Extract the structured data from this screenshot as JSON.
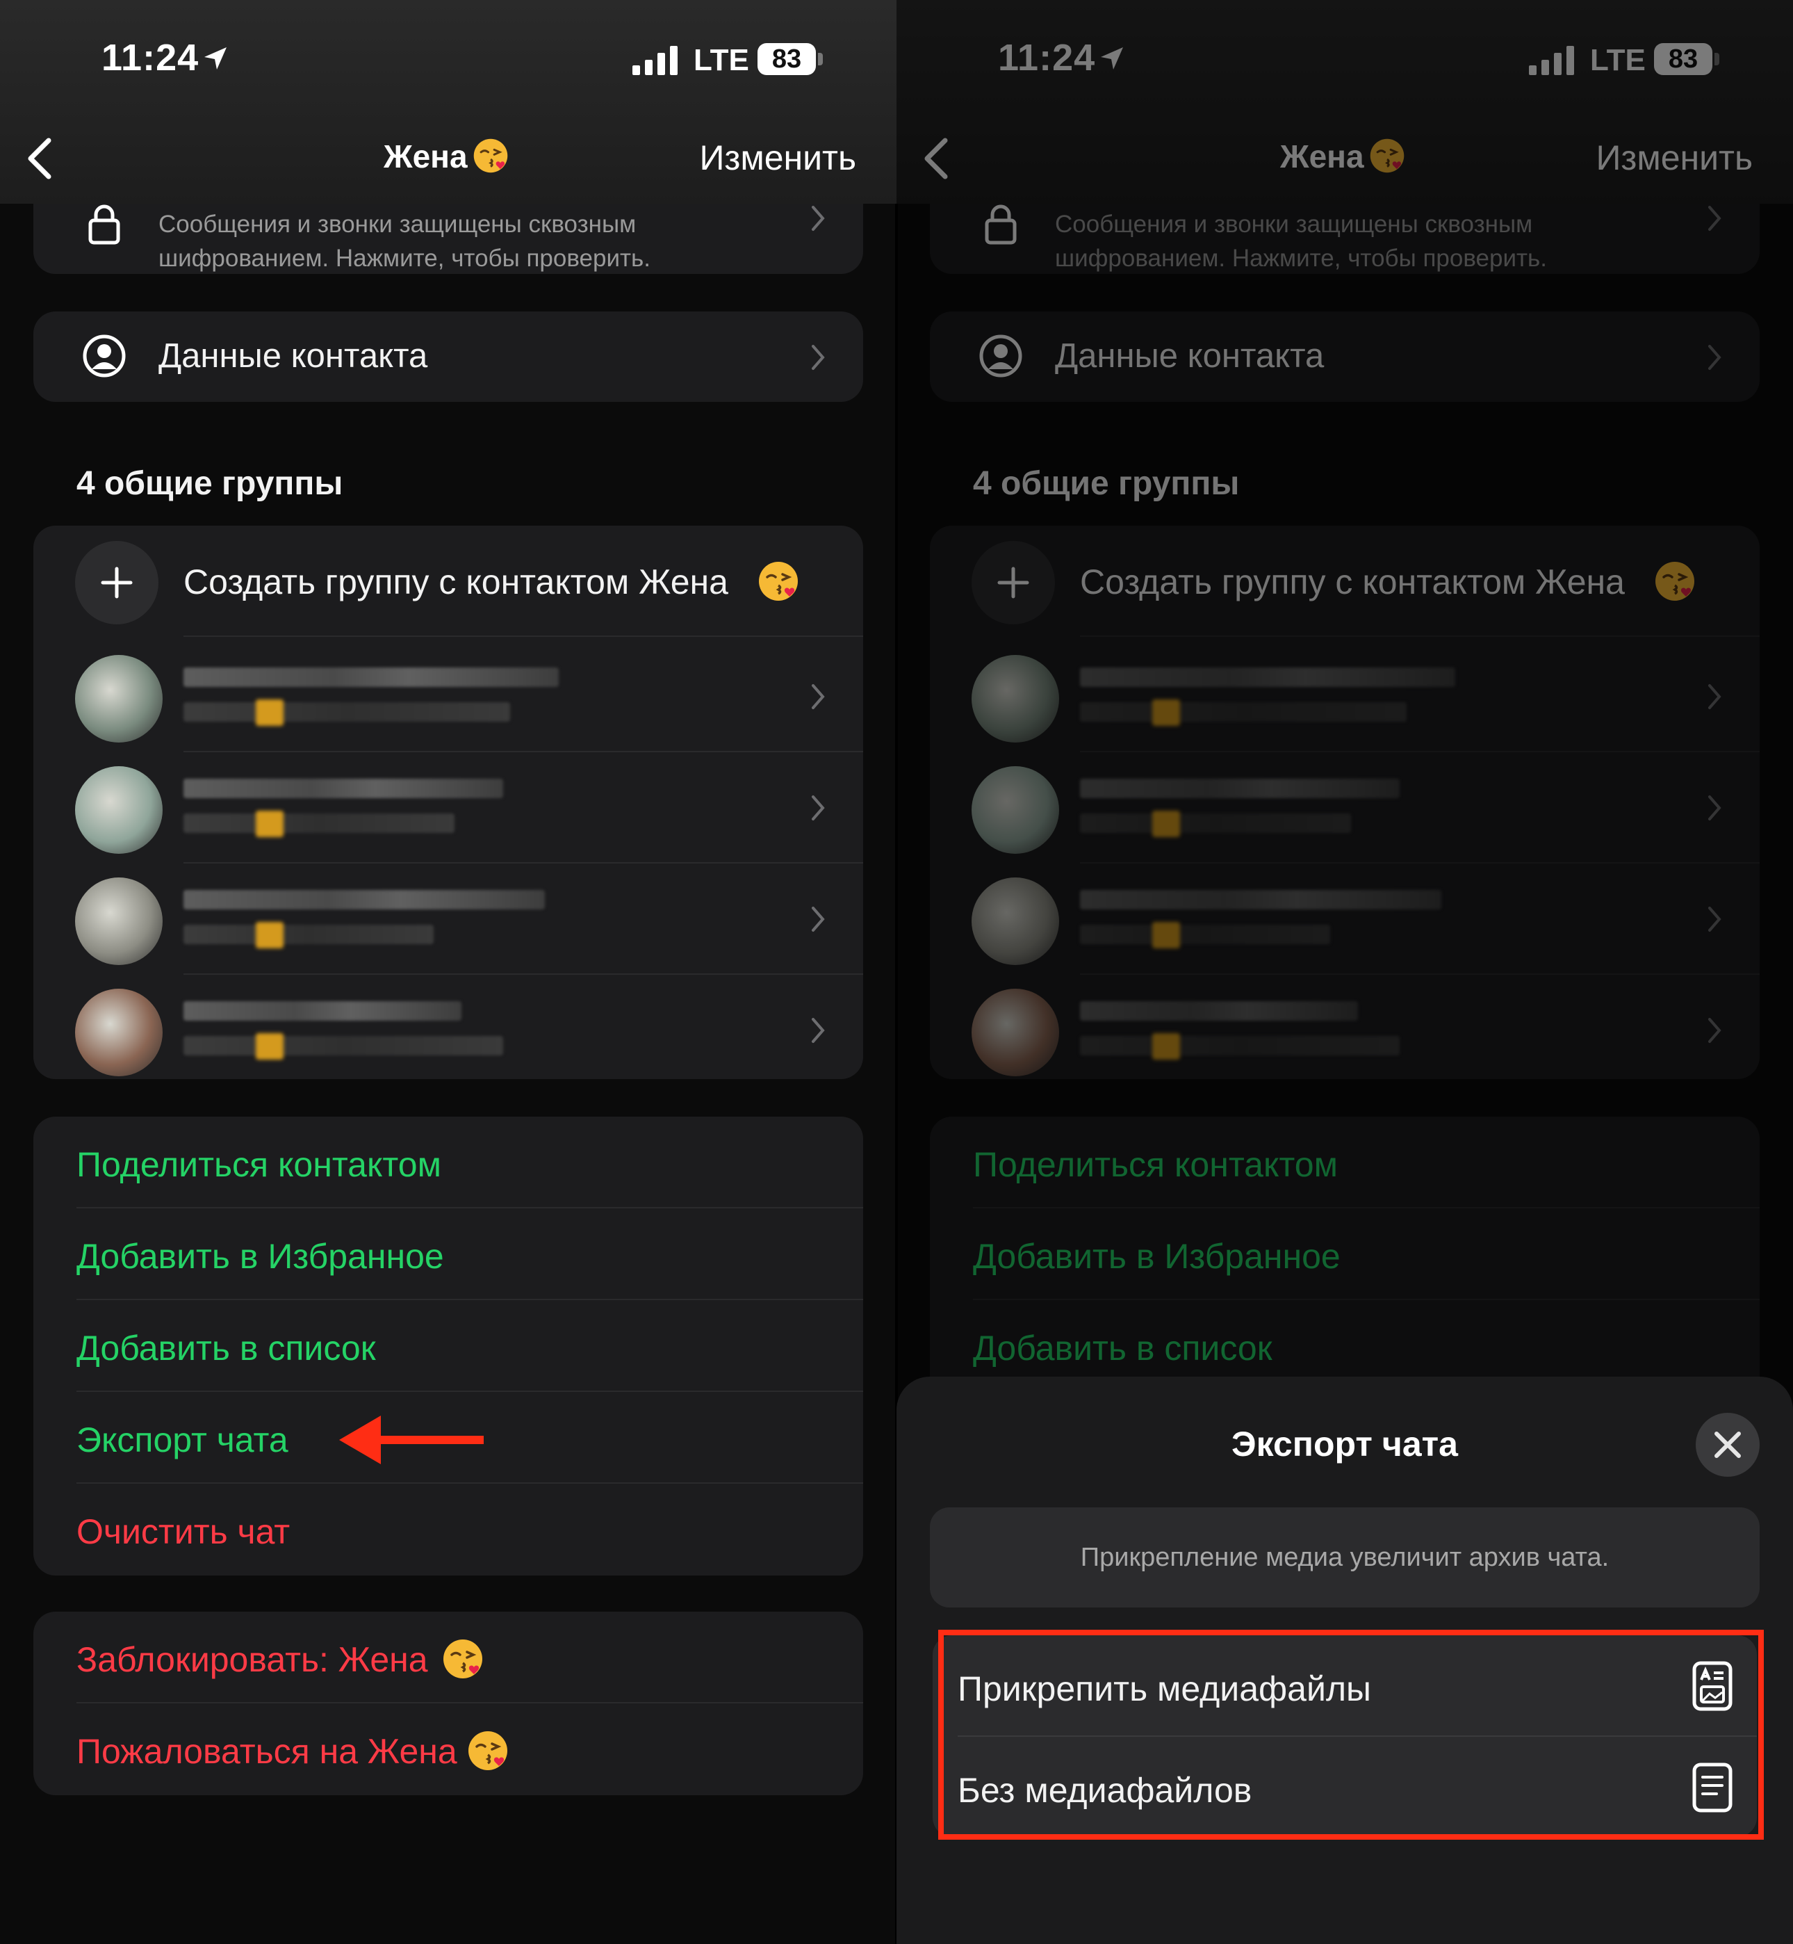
{
  "status": {
    "time": "11:24",
    "network": "LTE",
    "battery": "83"
  },
  "nav": {
    "title": "Жена",
    "edit_label": "Изменить"
  },
  "encryption": {
    "text": "Сообщения и звонки защищены сквозным шифрованием. Нажмите, чтобы проверить."
  },
  "contact_info": {
    "label": "Данные контакта"
  },
  "groups": {
    "heading": "4 общие группы",
    "create_label": "Создать группу с контактом Жена",
    "items": [
      {
        "avatar_color": "#7a8b7f"
      },
      {
        "avatar_color": "#8fa59a"
      },
      {
        "avatar_color": "#8d8d84"
      },
      {
        "avatar_color": "#8a6553"
      }
    ]
  },
  "actions": {
    "share": "Поделиться контактом",
    "favorite": "Добавить в Избранное",
    "add_list": "Добавить в список",
    "export": "Экспорт чата",
    "clear": "Очистить чат"
  },
  "danger": {
    "block": "Заблокировать: Жена",
    "report": "Пожаловаться на Жена"
  },
  "export_sheet": {
    "title": "Экспорт чата",
    "notice": "Прикрепление медиа увеличит архив чата.",
    "attach_media": "Прикрепить медиафайлы",
    "without_media": "Без медиафайлов"
  },
  "colors": {
    "accent_green": "#25d366",
    "danger_red": "#ff3b46",
    "highlight": "#ff2d14"
  },
  "icons": [
    "location-arrow-icon",
    "signal-icon",
    "battery-icon",
    "back-chevron-icon",
    "kiss-emoji-icon",
    "lock-icon",
    "person-circle-icon",
    "chevron-right-icon",
    "plus-icon",
    "close-icon",
    "document-media-icon",
    "document-icon",
    "red-arrow-icon"
  ]
}
